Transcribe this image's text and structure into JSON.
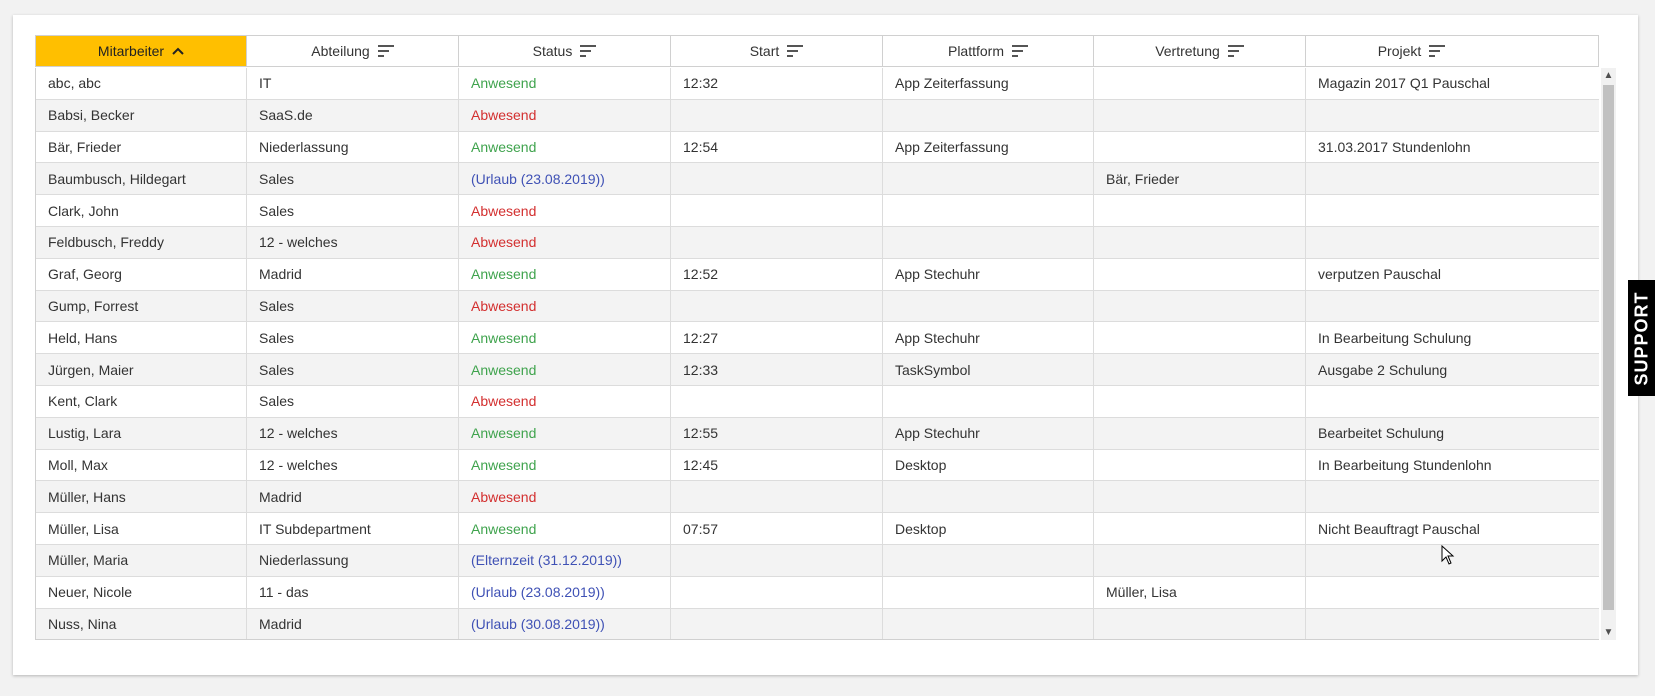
{
  "table": {
    "columns": [
      {
        "label": "Mitarbeiter",
        "icon": "sort-ascending-icon",
        "sorted": true
      },
      {
        "label": "Abteilung",
        "icon": "sort-icon",
        "sorted": false
      },
      {
        "label": "Status",
        "icon": "sort-icon",
        "sorted": false
      },
      {
        "label": "Start",
        "icon": "sort-icon",
        "sorted": false
      },
      {
        "label": "Plattform",
        "icon": "sort-icon",
        "sorted": false
      },
      {
        "label": "Vertretung",
        "icon": "sort-icon",
        "sorted": false
      },
      {
        "label": "Projekt",
        "icon": "sort-icon",
        "sorted": false
      }
    ],
    "rows": [
      {
        "mitarbeiter": "abc, abc",
        "abteilung": "IT",
        "status": "Anwesend",
        "status_type": "present",
        "start": "12:32",
        "plattform": "App Zeiterfassung",
        "vertretung": "",
        "projekt": "Magazin 2017 Q1 Pauschal"
      },
      {
        "mitarbeiter": "Babsi, Becker",
        "abteilung": "SaaS.de",
        "status": "Abwesend",
        "status_type": "absent",
        "start": "",
        "plattform": "",
        "vertretung": "",
        "projekt": ""
      },
      {
        "mitarbeiter": "Bär, Frieder",
        "abteilung": "Niederlassung",
        "status": "Anwesend",
        "status_type": "present",
        "start": "12:54",
        "plattform": "App Zeiterfassung",
        "vertretung": "",
        "projekt": "31.03.2017 Stundenlohn"
      },
      {
        "mitarbeiter": "Baumbusch, Hildegart",
        "abteilung": "Sales",
        "status": "(Urlaub (23.08.2019))",
        "status_type": "leave",
        "start": "",
        "plattform": "",
        "vertretung": "Bär, Frieder",
        "projekt": ""
      },
      {
        "mitarbeiter": "Clark, John",
        "abteilung": "Sales",
        "status": "Abwesend",
        "status_type": "absent",
        "start": "",
        "plattform": "",
        "vertretung": "",
        "projekt": ""
      },
      {
        "mitarbeiter": "Feldbusch, Freddy",
        "abteilung": "12 - welches",
        "status": "Abwesend",
        "status_type": "absent",
        "start": "",
        "plattform": "",
        "vertretung": "",
        "projekt": ""
      },
      {
        "mitarbeiter": "Graf, Georg",
        "abteilung": "Madrid",
        "status": "Anwesend",
        "status_type": "present",
        "start": "12:52",
        "plattform": "App Stechuhr",
        "vertretung": "",
        "projekt": "verputzen Pauschal"
      },
      {
        "mitarbeiter": "Gump, Forrest",
        "abteilung": "Sales",
        "status": "Abwesend",
        "status_type": "absent",
        "start": "",
        "plattform": "",
        "vertretung": "",
        "projekt": ""
      },
      {
        "mitarbeiter": "Held, Hans",
        "abteilung": "Sales",
        "status": "Anwesend",
        "status_type": "present",
        "start": "12:27",
        "plattform": "App Stechuhr",
        "vertretung": "",
        "projekt": "In Bearbeitung Schulung"
      },
      {
        "mitarbeiter": "Jürgen, Maier",
        "abteilung": "Sales",
        "status": "Anwesend",
        "status_type": "present",
        "start": "12:33",
        "plattform": "TaskSymbol",
        "vertretung": "",
        "projekt": "Ausgabe 2 Schulung"
      },
      {
        "mitarbeiter": "Kent, Clark",
        "abteilung": "Sales",
        "status": "Abwesend",
        "status_type": "absent",
        "start": "",
        "plattform": "",
        "vertretung": "",
        "projekt": ""
      },
      {
        "mitarbeiter": "Lustig, Lara",
        "abteilung": "12 - welches",
        "status": "Anwesend",
        "status_type": "present",
        "start": "12:55",
        "plattform": "App Stechuhr",
        "vertretung": "",
        "projekt": "Bearbeitet Schulung"
      },
      {
        "mitarbeiter": "Moll, Max",
        "abteilung": "12 - welches",
        "status": "Anwesend",
        "status_type": "present",
        "start": "12:45",
        "plattform": "Desktop",
        "vertretung": "",
        "projekt": "In Bearbeitung Stundenlohn"
      },
      {
        "mitarbeiter": "Müller, Hans",
        "abteilung": "Madrid",
        "status": "Abwesend",
        "status_type": "absent",
        "start": "",
        "plattform": "",
        "vertretung": "",
        "projekt": ""
      },
      {
        "mitarbeiter": "Müller, Lisa",
        "abteilung": "IT Subdepartment",
        "status": "Anwesend",
        "status_type": "present",
        "start": "07:57",
        "plattform": "Desktop",
        "vertretung": "",
        "projekt": "Nicht Beauftragt Pauschal"
      },
      {
        "mitarbeiter": "Müller, Maria",
        "abteilung": "Niederlassung",
        "status": "(Elternzeit (31.12.2019))",
        "status_type": "leave",
        "start": "",
        "plattform": "",
        "vertretung": "",
        "projekt": ""
      },
      {
        "mitarbeiter": "Neuer, Nicole",
        "abteilung": "11 - das",
        "status": "(Urlaub (23.08.2019))",
        "status_type": "leave",
        "start": "",
        "plattform": "",
        "vertretung": "Müller, Lisa",
        "projekt": ""
      },
      {
        "mitarbeiter": "Nuss, Nina",
        "abteilung": "Madrid",
        "status": "(Urlaub (30.08.2019))",
        "status_type": "leave",
        "start": "",
        "plattform": "",
        "vertretung": "",
        "projekt": ""
      }
    ]
  },
  "support_tab": {
    "label": "SUPPORT"
  },
  "colors": {
    "sorted_header_bg": "#ffbf00",
    "status_present": "#3fa34d",
    "status_absent": "#d32f2f",
    "status_leave": "#3f51b5"
  }
}
